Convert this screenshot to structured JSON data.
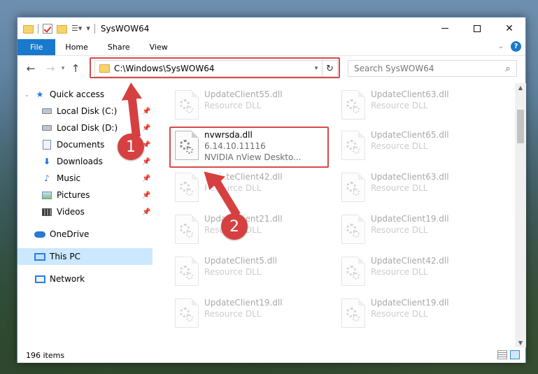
{
  "window": {
    "title": "SysWOW64",
    "controls": {
      "minimize": "minimize",
      "maximize": "maximize",
      "close": "✕"
    }
  },
  "ribbon": {
    "tabs": [
      "File",
      "Home",
      "Share",
      "View"
    ],
    "help": "?"
  },
  "address_bar": {
    "path": "C:\\Windows\\SysWOW64",
    "dropdown": "▾",
    "refresh": "↻"
  },
  "search": {
    "placeholder": "Search SysWOW64",
    "icon": "search-icon"
  },
  "sidebar": {
    "items": [
      {
        "label": "Quick access",
        "icon": "star-icon",
        "pinned": false
      },
      {
        "label": "Local Disk (C:)",
        "icon": "disk-icon",
        "pinned": true
      },
      {
        "label": "Local Disk (D:)",
        "icon": "disk-icon",
        "pinned": true
      },
      {
        "label": "Documents",
        "icon": "documents-icon",
        "pinned": true
      },
      {
        "label": "Downloads",
        "icon": "downloads-icon",
        "pinned": true
      },
      {
        "label": "Music",
        "icon": "music-icon",
        "pinned": true
      },
      {
        "label": "Pictures",
        "icon": "pictures-icon",
        "pinned": true
      },
      {
        "label": "Videos",
        "icon": "videos-icon",
        "pinned": true
      },
      {
        "label": "OneDrive",
        "icon": "onedrive-icon",
        "pinned": false
      },
      {
        "label": "This PC",
        "icon": "this-pc-icon",
        "pinned": false,
        "selected": true
      },
      {
        "label": "Network",
        "icon": "network-icon",
        "pinned": false
      }
    ]
  },
  "files": {
    "highlighted": {
      "name": "nvwrsda.dll",
      "version": "6.14.10.11116",
      "description": "NVIDIA nView Deskto..."
    },
    "left_column": [
      {
        "name": "UpdateClient55.dll",
        "type": "Resource DLL"
      },
      {
        "name": "UpdateClient42.dll",
        "type": "Resource DLL"
      },
      {
        "name": "UpdateClient21.dll",
        "type": "Resource DLL"
      },
      {
        "name": "UpdateClient5.dll",
        "type": "Resource DLL"
      },
      {
        "name": "UpdateClient19.dll",
        "type": "Resource DLL"
      }
    ],
    "right_column": [
      {
        "name": "UpdateClient63.dll",
        "type": "Resource DLL"
      },
      {
        "name": "UpdateClient65.dll",
        "type": "Resource DLL"
      },
      {
        "name": "UpdateClient63.dll",
        "type": "Resource DLL"
      },
      {
        "name": "UpdateClient19.dll",
        "type": "Resource DLL"
      },
      {
        "name": "UpdateClient42.dll",
        "type": "Resource DLL"
      },
      {
        "name": "UpdateClient19.dll",
        "type": "Resource DLL"
      }
    ]
  },
  "status": {
    "item_count": "196 items"
  },
  "annotations": {
    "step1": "1",
    "step2": "2",
    "color": "#d64040"
  }
}
